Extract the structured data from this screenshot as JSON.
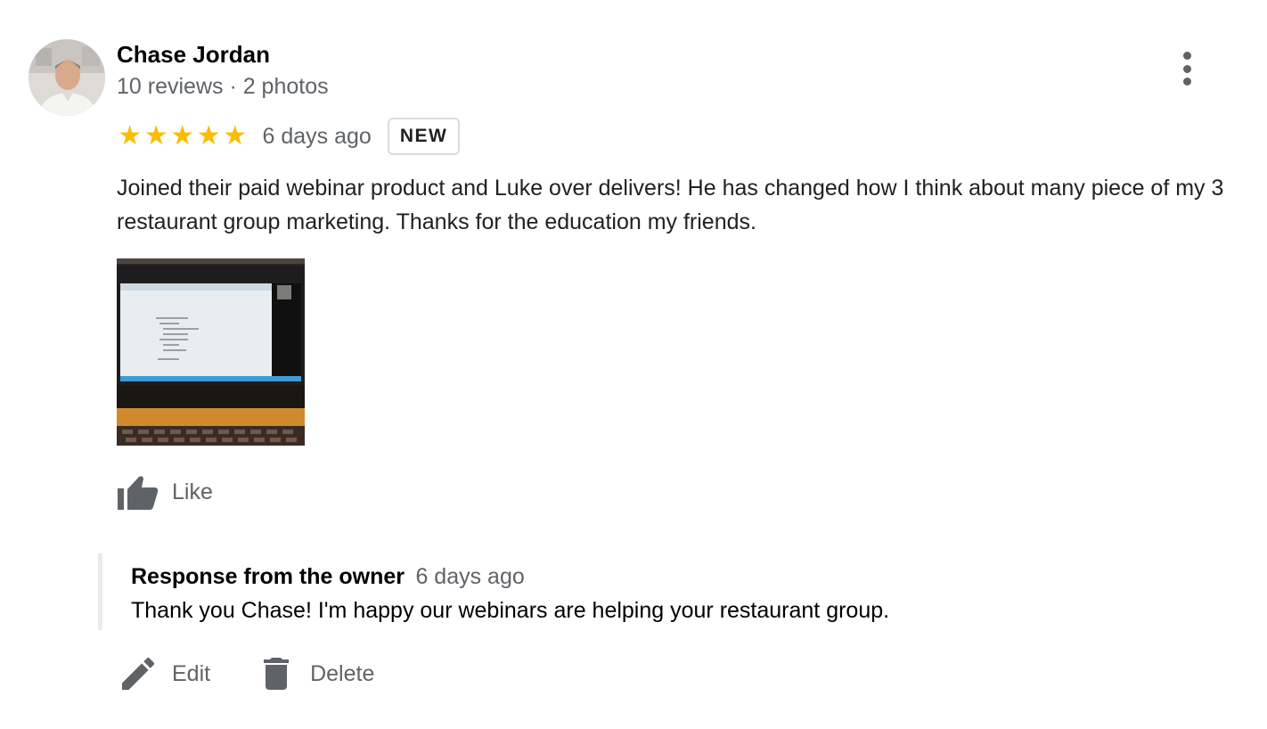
{
  "reviewer": {
    "name": "Chase Jordan",
    "meta": "10 reviews · 2 photos",
    "avatar_icon": "user-avatar-photo"
  },
  "rating": {
    "stars": 5,
    "max_stars": 5,
    "star_glyph": "★",
    "star_color": "#fbbc04",
    "time_ago": "6 days ago",
    "badge": "NEW"
  },
  "review": {
    "text": "Joined their paid webinar product and Luke over delivers! He has changed how I think about many piece of my 3 restaurant group marketing. Thanks for the education my friends.",
    "photo_icon": "review-photo-laptop-webinar"
  },
  "actions": {
    "like_label": "Like",
    "like_icon": "thumbs-up-icon",
    "more_icon": "more-vert-icon",
    "edit_label": "Edit",
    "edit_icon": "pencil-icon",
    "delete_label": "Delete",
    "delete_icon": "trash-icon"
  },
  "owner_response": {
    "title": "Response from the owner",
    "time_ago": "6 days ago",
    "text": "Thank you Chase! I'm happy our webinars are helping your restaurant group."
  },
  "colors": {
    "secondary_text": "#5f6368",
    "primary_text": "#202124",
    "divider": "#e8eaed",
    "star": "#fbbc04"
  }
}
